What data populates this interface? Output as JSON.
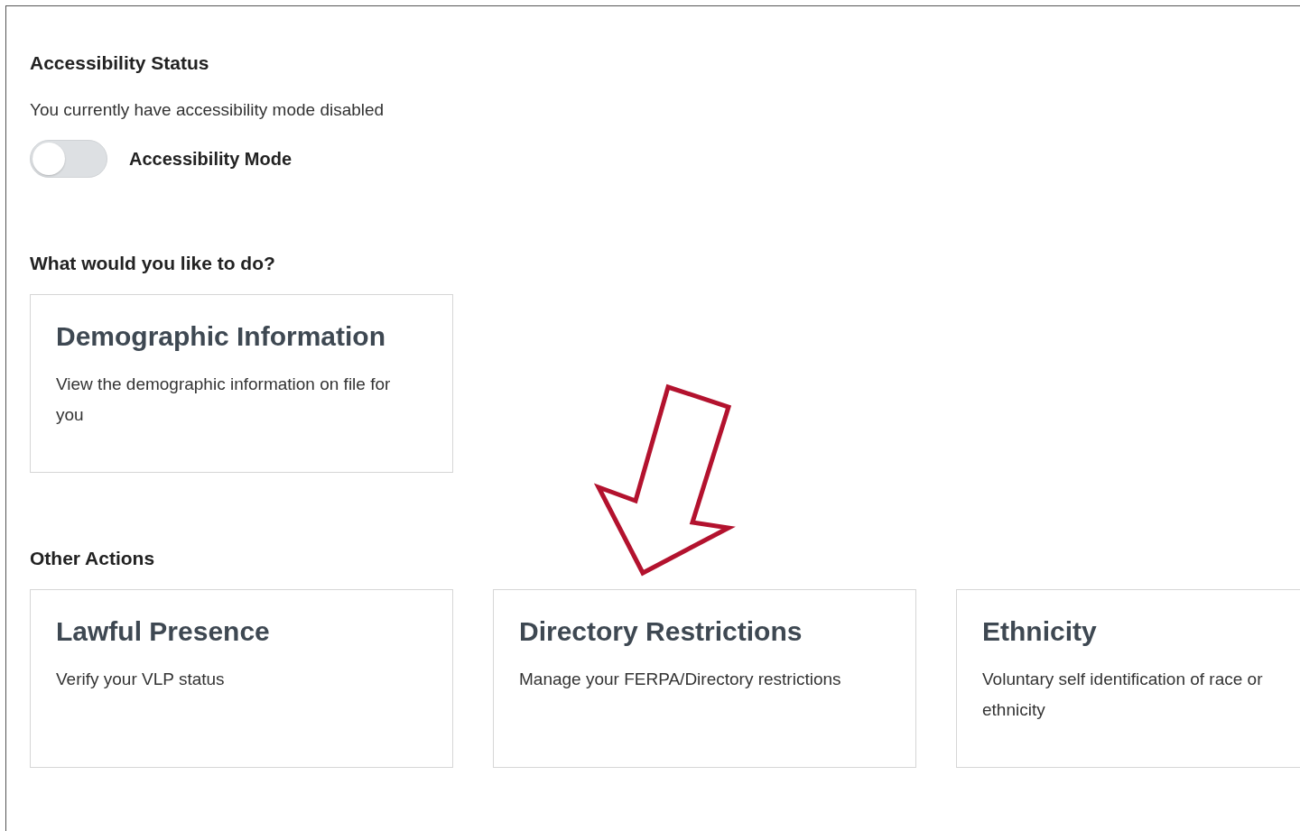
{
  "accessibility": {
    "title": "Accessibility Status",
    "status_text": "You currently have accessibility mode disabled",
    "toggle_label": "Accessibility Mode",
    "on": false
  },
  "primary": {
    "heading": "What would you like to do?",
    "cards": [
      {
        "title": "Demographic Information",
        "description": "View the demographic information on file for you"
      }
    ]
  },
  "other": {
    "heading": "Other Actions",
    "cards": [
      {
        "title": "Lawful Presence",
        "description": "Verify your VLP status"
      },
      {
        "title": "Directory Restrictions",
        "description": "Manage your FERPA/Directory restrictions"
      },
      {
        "title": "Ethnicity",
        "description": "Voluntary self identification of race or ethnicity"
      }
    ]
  }
}
